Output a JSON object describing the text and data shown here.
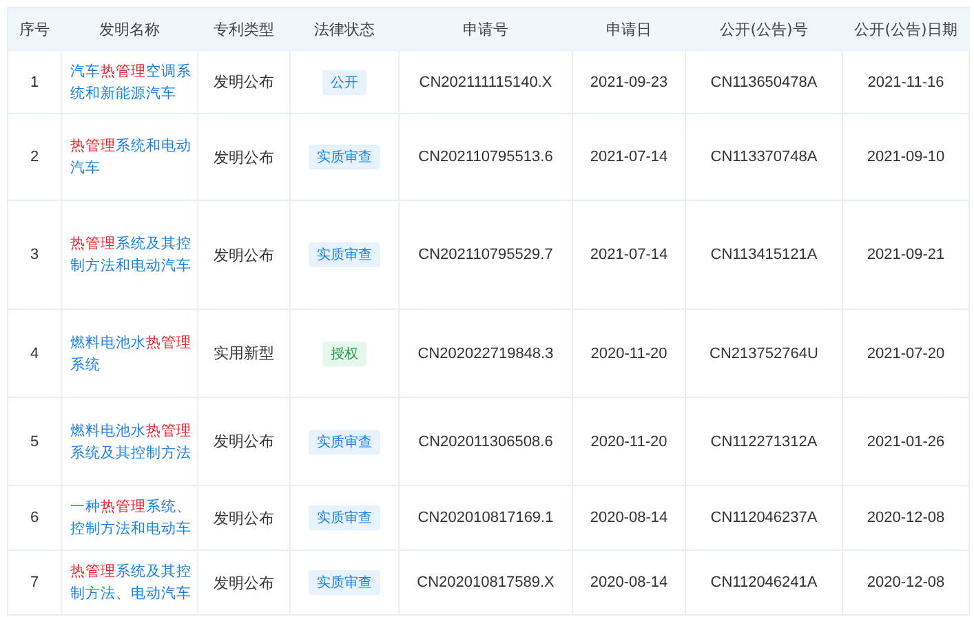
{
  "table": {
    "columns": [
      "序号",
      "发明名称",
      "专利类型",
      "法律状态",
      "申请号",
      "申请日",
      "公开(公告)号",
      "公开(公告)日期"
    ],
    "rows": [
      {
        "index": "1",
        "title": [
          {
            "text": "汽车",
            "highlight": false
          },
          {
            "text": "热管理",
            "highlight": true
          },
          {
            "text": "空调系统和新能源汽车",
            "highlight": false
          }
        ],
        "type": "发明公布",
        "status": {
          "label": "公开",
          "kind": "public"
        },
        "application_no": "CN202111115140.X",
        "application_date": "2021-09-23",
        "publication_no": "CN113650478A",
        "publication_date": "2021-11-16"
      },
      {
        "index": "2",
        "title": [
          {
            "text": "热管理",
            "highlight": true
          },
          {
            "text": "系统和电动汽车",
            "highlight": false
          }
        ],
        "type": "发明公布",
        "status": {
          "label": "实质审查",
          "kind": "examination"
        },
        "application_no": "CN202110795513.6",
        "application_date": "2021-07-14",
        "publication_no": "CN113370748A",
        "publication_date": "2021-09-10"
      },
      {
        "index": "3",
        "title": [
          {
            "text": "热管理",
            "highlight": true
          },
          {
            "text": "系统及其控制方法和电动汽车",
            "highlight": false
          }
        ],
        "type": "发明公布",
        "status": {
          "label": "实质审查",
          "kind": "examination"
        },
        "application_no": "CN202110795529.7",
        "application_date": "2021-07-14",
        "publication_no": "CN113415121A",
        "publication_date": "2021-09-21"
      },
      {
        "index": "4",
        "title": [
          {
            "text": "燃料电池水",
            "highlight": false
          },
          {
            "text": "热管理",
            "highlight": true
          },
          {
            "text": "系统",
            "highlight": false
          }
        ],
        "type": "实用新型",
        "status": {
          "label": "授权",
          "kind": "granted"
        },
        "application_no": "CN202022719848.3",
        "application_date": "2020-11-20",
        "publication_no": "CN213752764U",
        "publication_date": "2021-07-20"
      },
      {
        "index": "5",
        "title": [
          {
            "text": "燃料电池水",
            "highlight": false
          },
          {
            "text": "热管理",
            "highlight": true
          },
          {
            "text": "系统及其控制方法",
            "highlight": false
          }
        ],
        "type": "发明公布",
        "status": {
          "label": "实质审查",
          "kind": "examination"
        },
        "application_no": "CN202011306508.6",
        "application_date": "2020-11-20",
        "publication_no": "CN112271312A",
        "publication_date": "2021-01-26"
      },
      {
        "index": "6",
        "title": [
          {
            "text": "一种",
            "highlight": false
          },
          {
            "text": "热管理",
            "highlight": true
          },
          {
            "text": "系统、控制方法和电动车",
            "highlight": false
          }
        ],
        "type": "发明公布",
        "status": {
          "label": "实质审查",
          "kind": "examination"
        },
        "application_no": "CN202010817169.1",
        "application_date": "2020-08-14",
        "publication_no": "CN112046237A",
        "publication_date": "2020-12-08"
      },
      {
        "index": "7",
        "title": [
          {
            "text": "热管理",
            "highlight": true
          },
          {
            "text": "系统及其控制方法、电动汽车",
            "highlight": false
          }
        ],
        "type": "发明公布",
        "status": {
          "label": "实质审查",
          "kind": "examination"
        },
        "application_no": "CN202010817589.X",
        "application_date": "2020-08-14",
        "publication_no": "CN112046241A",
        "publication_date": "2020-12-08"
      }
    ]
  }
}
